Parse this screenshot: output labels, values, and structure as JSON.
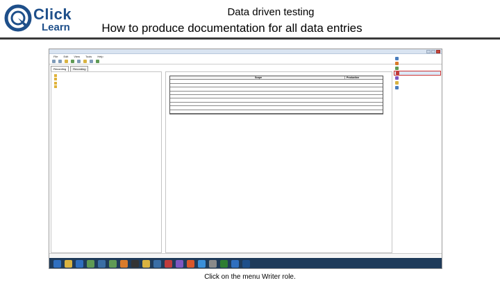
{
  "slide": {
    "logo": {
      "word1": "Click",
      "word2": "Learn"
    },
    "title": "Data driven testing",
    "subtitle": "How to produce documentation for all data entries",
    "caption": "Click on the menu Writer role."
  },
  "app": {
    "menus": [
      "File",
      "Edit",
      "View",
      "Tools",
      "Help"
    ],
    "tabs": [
      "Recording",
      "Recording"
    ],
    "grid_headers": [
      "",
      "Scope",
      "Production"
    ],
    "right_menu": [
      {
        "label": "",
        "color": "#4a7dbd"
      },
      {
        "label": "",
        "color": "#d97b2b"
      },
      {
        "label": "",
        "color": "#5f9a54"
      },
      {
        "label": "",
        "color": "#c03c3c"
      },
      {
        "label": "",
        "color": "#7e57c2"
      },
      {
        "label": "",
        "color": "#d9b341"
      },
      {
        "label": "",
        "color": "#4a7dbd"
      }
    ],
    "taskbar_icons": [
      {
        "name": "start-button",
        "color": "#2f6fbf"
      },
      {
        "name": "explorer-icon",
        "color": "#d9b341"
      },
      {
        "name": "outlook-icon",
        "color": "#2f6fbf"
      },
      {
        "name": "chart-icon",
        "color": "#5f9a54"
      },
      {
        "name": "app-icon",
        "color": "#3a6ea5"
      },
      {
        "name": "chrome-icon",
        "color": "#5f9a54"
      },
      {
        "name": "firefox-icon",
        "color": "#d97b2b"
      },
      {
        "name": "terminal-icon",
        "color": "#333333"
      },
      {
        "name": "folder-icon",
        "color": "#d9b341"
      },
      {
        "name": "app2-icon",
        "color": "#3a6ea5"
      },
      {
        "name": "media-icon",
        "color": "#c03c3c"
      },
      {
        "name": "vs-icon",
        "color": "#7e57c2"
      },
      {
        "name": "powerpoint-icon",
        "color": "#d9572b"
      },
      {
        "name": "ie-icon",
        "color": "#3a8fd9"
      },
      {
        "name": "tool-icon",
        "color": "#8a8a8a"
      },
      {
        "name": "excel-icon",
        "color": "#2e7d32"
      },
      {
        "name": "word-icon",
        "color": "#2f6fbf"
      },
      {
        "name": "clicklearn-icon",
        "color": "#1e4f8a"
      }
    ]
  }
}
